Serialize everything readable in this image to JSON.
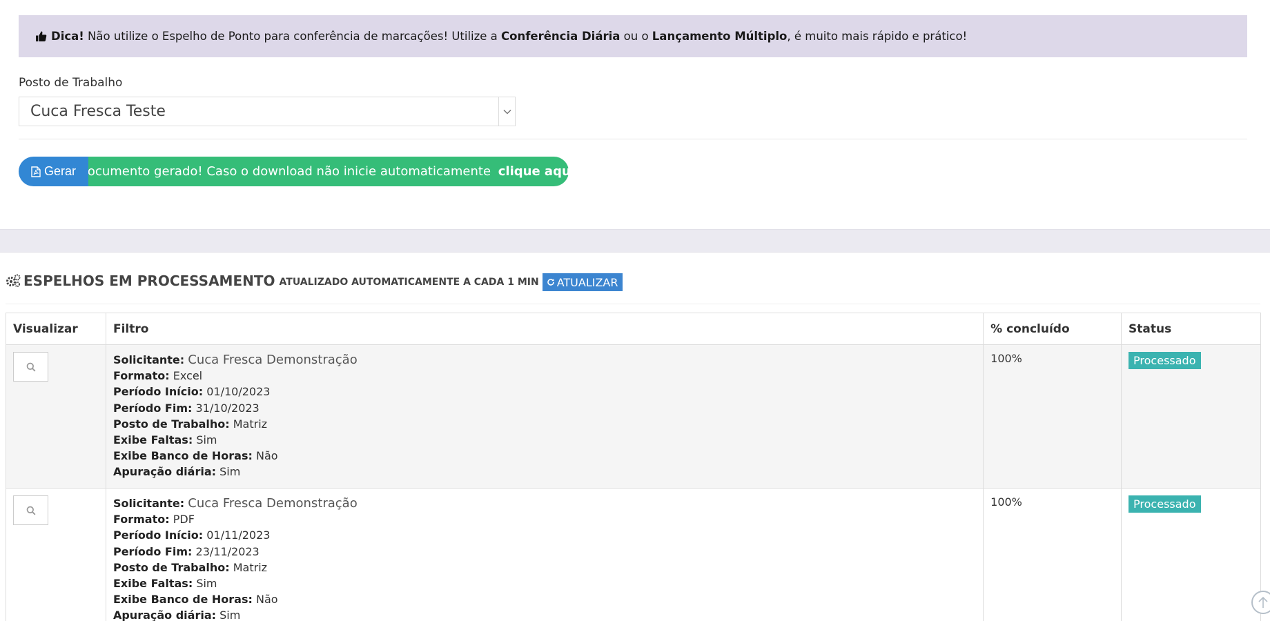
{
  "tip": {
    "label": "Dica!",
    "text1": " Não utilize o Espelho de Ponto para conferência de marcações! Utilize a ",
    "link1": "Conferência Diária",
    "text2": " ou o ",
    "link2": "Lançamento Múltiplo",
    "text3": ", é muito mais rápido e prático!",
    "icon": "thumbs-up-icon"
  },
  "form": {
    "posto_label": "Posto de Trabalho",
    "posto_value": "Cuca Fresca Teste"
  },
  "actions": {
    "gerar_label": "Gerar",
    "download_text": "Documento gerado! Caso o download não inicie automaticamente ",
    "download_link": "clique aqui"
  },
  "processing": {
    "title": "ESPELHOS EM PROCESSAMENTO",
    "subtitle": "ATUALIZADO AUTOMATICAMENTE A CADA 1 MIN",
    "refresh_label": "ATUALIZAR"
  },
  "table": {
    "headers": [
      "Visualizar",
      "Filtro",
      "% concluído",
      "Status"
    ],
    "field_labels": {
      "solicitante": "Solicitante:",
      "formato": "Formato:",
      "inicio": "Período Início:",
      "fim": "Período Fim:",
      "posto": "Posto de Trabalho:",
      "faltas": "Exibe Faltas:",
      "banco": "Exibe Banco de Horas:",
      "apuracao": "Apuração diária:"
    },
    "rows": [
      {
        "solicitante": "Cuca Fresca Demonstração",
        "formato": "Excel",
        "inicio": "01/10/2023",
        "fim": "31/10/2023",
        "posto": "Matriz",
        "faltas": "Sim",
        "banco": "Não",
        "apuracao": "Sim",
        "percent": "100%",
        "status": "Processado"
      },
      {
        "solicitante": "Cuca Fresca Demonstração",
        "formato": "PDF",
        "inicio": "01/11/2023",
        "fim": "23/11/2023",
        "posto": "Matriz",
        "faltas": "Sim",
        "banco": "Não",
        "apuracao": "Sim",
        "percent": "100%",
        "status": "Processado"
      }
    ]
  },
  "colors": {
    "tip_bg": "#ddd8e9",
    "primary": "#3287d4",
    "success": "#35bd78",
    "status_teal": "#3bb3b0"
  }
}
